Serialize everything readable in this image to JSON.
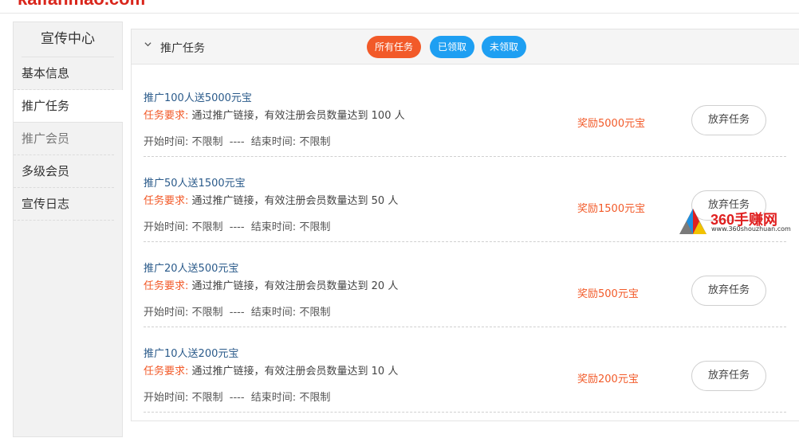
{
  "site": {
    "brand": "kaifanmao.com"
  },
  "sidebar": {
    "title": "宣传中心",
    "items": [
      {
        "label": "基本信息"
      },
      {
        "label": "推广任务"
      },
      {
        "label": "推广会员"
      },
      {
        "label": "多级会员"
      },
      {
        "label": "宣传日志"
      }
    ]
  },
  "header": {
    "title": "推广任务",
    "filters": {
      "all": "所有任务",
      "received": "已领取",
      "unreceived": "未领取"
    }
  },
  "tasks": [
    {
      "title": "推广100人送5000元宝",
      "req_label": "任务要求:",
      "req_text": "通过推广链接，有效注册会员数量达到 100 人",
      "time": "开始时间: 不限制  ----  结束时间: 不限制",
      "reward": "奖励5000元宝",
      "button": "放弃任务"
    },
    {
      "title": "推广50人送1500元宝",
      "req_label": "任务要求:",
      "req_text": "通过推广链接，有效注册会员数量达到 50 人",
      "time": "开始时间: 不限制  ----  结束时间: 不限制",
      "reward": "奖励1500元宝",
      "button": "放弃任务"
    },
    {
      "title": "推广20人送500元宝",
      "req_label": "任务要求:",
      "req_text": "通过推广链接，有效注册会员数量达到 20 人",
      "time": "开始时间: 不限制  ----  结束时间: 不限制",
      "reward": "奖励500元宝",
      "button": "放弃任务"
    },
    {
      "title": "推广10人送200元宝",
      "req_label": "任务要求:",
      "req_text": "通过推广链接，有效注册会员数量达到 10 人",
      "time": "开始时间: 不限制  ----  结束时间: 不限制",
      "reward": "奖励200元宝",
      "button": "放弃任务"
    }
  ],
  "watermark": {
    "text": "360手赚网",
    "url": "www.360shouzhuan.com"
  },
  "colors": {
    "accent_orange": "#f25a29",
    "accent_blue": "#1e9ff2",
    "title_blue": "#2a5a8a",
    "brand_red": "#d9261c"
  }
}
